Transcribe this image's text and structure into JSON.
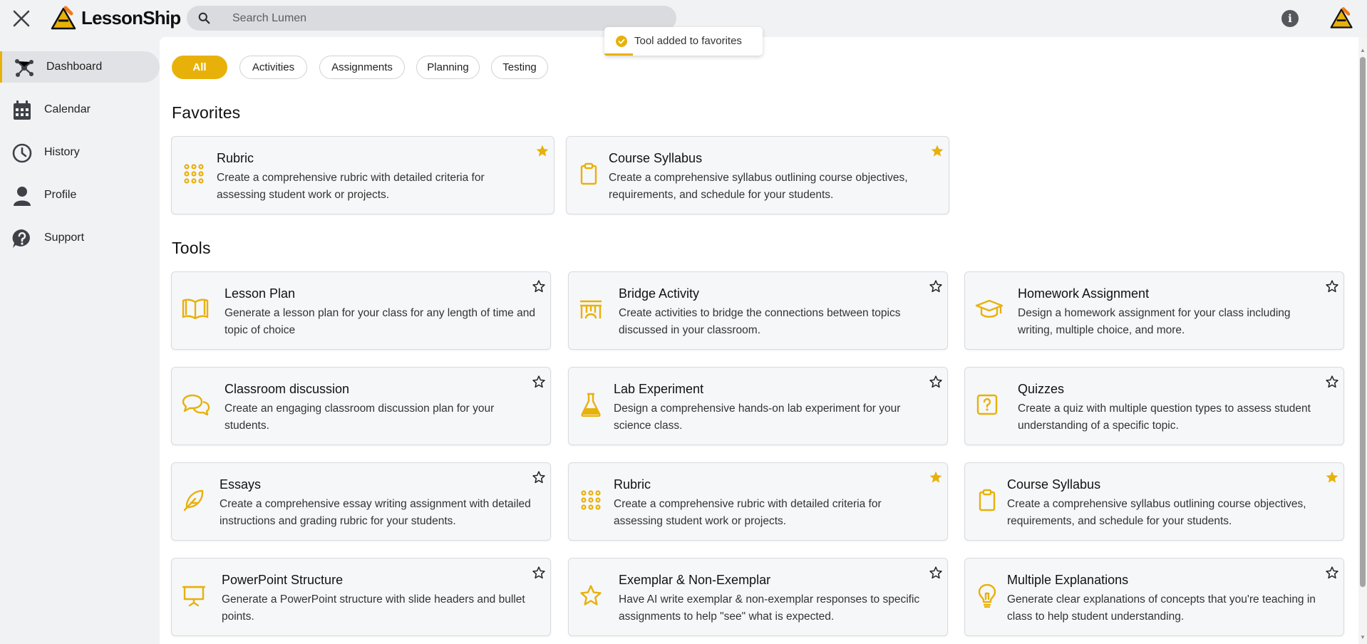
{
  "header": {
    "app_name": "LessonShip",
    "search_placeholder": "Search Lumen",
    "info_glyph": "i"
  },
  "sidebar": {
    "items": [
      {
        "label": "Dashboard",
        "icon": "dashboard-icon",
        "active": true
      },
      {
        "label": "Calendar",
        "icon": "calendar-icon",
        "active": false
      },
      {
        "label": "History",
        "icon": "clock-icon",
        "active": false
      },
      {
        "label": "Profile",
        "icon": "person-icon",
        "active": false
      },
      {
        "label": "Support",
        "icon": "help-icon",
        "active": false
      }
    ]
  },
  "filters": {
    "chips": [
      {
        "label": "All",
        "active": true
      },
      {
        "label": "Activities",
        "active": false
      },
      {
        "label": "Assignments",
        "active": false
      },
      {
        "label": "Planning",
        "active": false
      },
      {
        "label": "Testing",
        "active": false
      }
    ]
  },
  "toast": {
    "message": "Tool added to favorites"
  },
  "favorites": {
    "title": "Favorites",
    "cards": [
      {
        "title": "Rubric",
        "desc": "Create a comprehensive rubric with detailed criteria for assessing student work or projects.",
        "icon": "grid-icon",
        "starred": true
      },
      {
        "title": "Course Syllabus",
        "desc": "Create a comprehensive syllabus outlining course objectives, requirements, and schedule for your students.",
        "icon": "clipboard-icon",
        "starred": true
      }
    ]
  },
  "tools": {
    "title": "Tools",
    "cards": [
      {
        "title": "Lesson Plan",
        "desc": "Generate a lesson plan for your class for any length of time and topic of choice",
        "icon": "book-icon",
        "starred": false
      },
      {
        "title": "Bridge Activity",
        "desc": "Create activities to bridge the connections between topics discussed in your classroom.",
        "icon": "bridge-icon",
        "starred": false
      },
      {
        "title": "Homework Assignment",
        "desc": "Design a homework assignment for your class including writing, multiple choice, and more.",
        "icon": "graduation-cap-icon",
        "starred": false
      },
      {
        "title": "Classroom discussion",
        "desc": "Create an engaging classroom discussion plan for your students.",
        "icon": "chat-bubbles-icon",
        "starred": false
      },
      {
        "title": "Lab Experiment",
        "desc": "Design a comprehensive hands-on lab experiment for your science class.",
        "icon": "flask-icon",
        "starred": false
      },
      {
        "title": "Quizzes",
        "desc": "Create a quiz with multiple question types to assess student understanding of a specific topic.",
        "icon": "quiz-icon",
        "starred": false
      },
      {
        "title": "Essays",
        "desc": "Create a comprehensive essay writing assignment with detailed instructions and grading rubric for your students.",
        "icon": "feather-icon",
        "starred": false
      },
      {
        "title": "Rubric",
        "desc": "Create a comprehensive rubric with detailed criteria for assessing student work or projects.",
        "icon": "grid-icon",
        "starred": true
      },
      {
        "title": "Course Syllabus",
        "desc": "Create a comprehensive syllabus outlining course objectives, requirements, and schedule for your students.",
        "icon": "clipboard-icon",
        "starred": true
      },
      {
        "title": "PowerPoint Structure",
        "desc": "Generate a PowerPoint structure with slide headers and bullet points.",
        "icon": "presentation-icon",
        "starred": false
      },
      {
        "title": "Exemplar & Non-Exemplar",
        "desc": "Have AI write exemplar & non-exemplar responses to specific assignments to help \"see\" what is expected.",
        "icon": "star-outline-icon",
        "starred": false
      },
      {
        "title": "Multiple Explanations",
        "desc": "Generate clear explanations of concepts that you're teaching in class to help student understanding.",
        "icon": "lightbulb-icon",
        "starred": false
      }
    ]
  },
  "colors": {
    "accent": "#e8b10a",
    "icon_dark": "#3e4147"
  }
}
